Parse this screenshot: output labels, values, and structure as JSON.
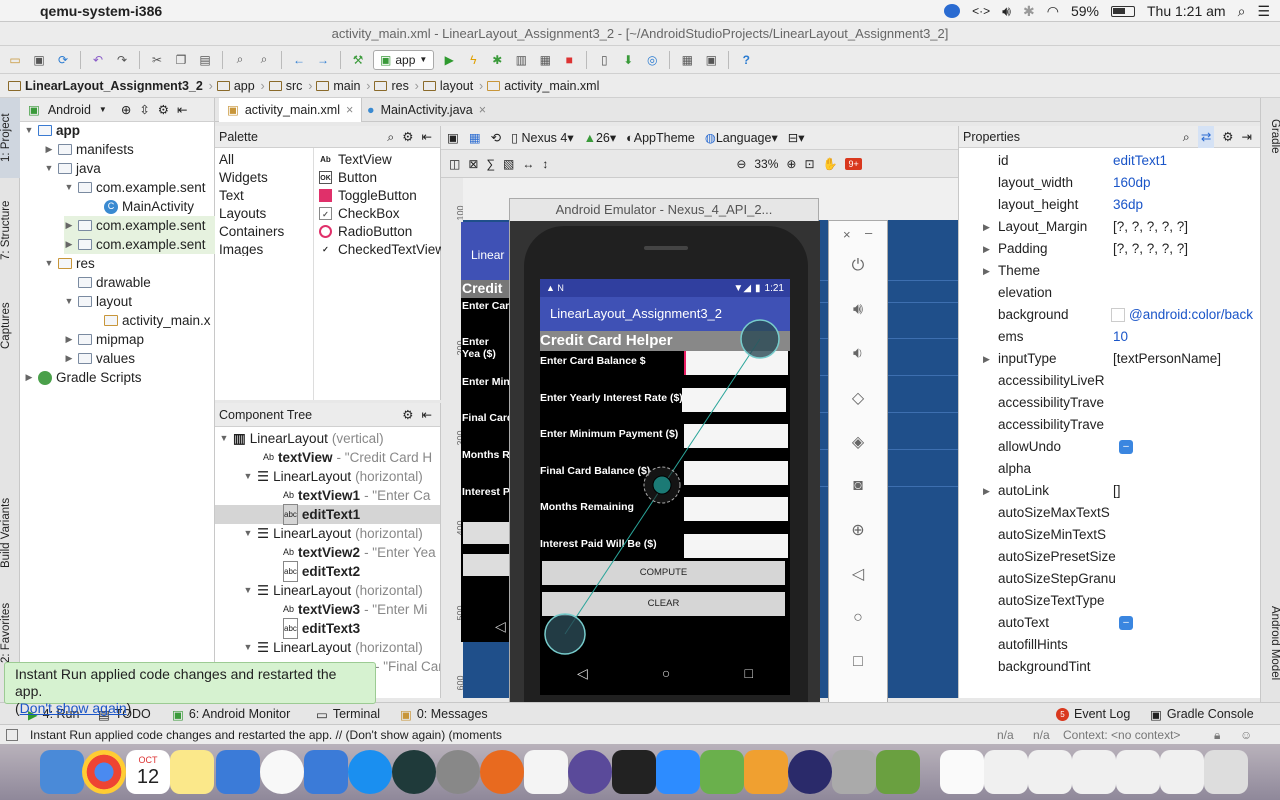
{
  "menubar": {
    "app_name": "qemu-system-i386",
    "battery": "59%",
    "clock": "Thu 1:21 am"
  },
  "window": {
    "title": "activity_main.xml - LinearLayout_Assignment3_2 - [~/AndroidStudioProjects/LinearLayout_Assignment3_2]"
  },
  "toolbar": {
    "run_config": "app"
  },
  "breadcrumbs": [
    "LinearLayout_Assignment3_2",
    "app",
    "src",
    "main",
    "res",
    "layout",
    "activity_main.xml"
  ],
  "left_tabs": [
    "1: Project",
    "7: Structure",
    "Captures",
    "Build Variants",
    "2: Favorites"
  ],
  "right_tabs": [
    "Gradle",
    "Android Model"
  ],
  "project": {
    "view_mode": "Android",
    "items": [
      "app",
      "manifests",
      "java",
      "com.example.sent",
      "MainActivity",
      "com.example.sent",
      "com.example.sent",
      "res",
      "drawable",
      "layout",
      "activity_main.x",
      "mipmap",
      "values",
      "Gradle Scripts"
    ]
  },
  "editor_tabs": [
    "activity_main.xml",
    "MainActivity.java"
  ],
  "palette": {
    "title": "Palette",
    "categories": [
      "All",
      "Widgets",
      "Text",
      "Layouts",
      "Containers",
      "Images"
    ],
    "widgets": [
      "TextView",
      "Button",
      "ToggleButton",
      "CheckBox",
      "RadioButton",
      "CheckedTextView"
    ]
  },
  "component_tree": {
    "title": "Component Tree",
    "rows": [
      {
        "name": "LinearLayout",
        "extra": "(vertical)"
      },
      {
        "name": "textView",
        "extra": "- \"Credit Card H"
      },
      {
        "name": "LinearLayout",
        "extra": "(horizontal)"
      },
      {
        "name": "textView1",
        "extra": "- \"Enter Ca"
      },
      {
        "name": "editText1",
        "extra": ""
      },
      {
        "name": "LinearLayout",
        "extra": "(horizontal)"
      },
      {
        "name": "textView2",
        "extra": "- \"Enter Yea"
      },
      {
        "name": "editText2",
        "extra": ""
      },
      {
        "name": "LinearLayout",
        "extra": "(horizontal)"
      },
      {
        "name": "textView3",
        "extra": "- \"Enter Mi"
      },
      {
        "name": "editText3",
        "extra": ""
      },
      {
        "name": "LinearLayout",
        "extra": "(horizontal)"
      },
      {
        "name": "",
        "extra": "- \"Final Car"
      }
    ]
  },
  "design_toolbar": {
    "device": "Nexus 4",
    "api": "26",
    "theme": "AppTheme",
    "language": "Language",
    "zoom": "33%"
  },
  "blueprint_texts": [
    "Linear",
    "Credit",
    "Enter Car",
    "Enter Yea ($)",
    "Enter Min",
    "Final Card",
    "Months R",
    "Interest P"
  ],
  "ruler_marks": [
    "100",
    "200",
    "300",
    "400",
    "500",
    "600"
  ],
  "properties": {
    "title": "Properties",
    "rows": [
      {
        "name": "id",
        "value": "editText1"
      },
      {
        "name": "layout_width",
        "value": "160dp"
      },
      {
        "name": "layout_height",
        "value": "36dp"
      },
      {
        "name": "Layout_Margin",
        "value": "[?, ?, ?, ?, ?]"
      },
      {
        "name": "Padding",
        "value": "[?, ?, ?, ?, ?]"
      },
      {
        "name": "Theme",
        "value": ""
      },
      {
        "name": "elevation",
        "value": ""
      },
      {
        "name": "background",
        "value": "@android:color/back"
      },
      {
        "name": "ems",
        "value": "10"
      },
      {
        "name": "inputType",
        "value": "[textPersonName]"
      },
      {
        "name": "accessibilityLiveR",
        "value": ""
      },
      {
        "name": "accessibilityTrave",
        "value": ""
      },
      {
        "name": "accessibilityTrave",
        "value": ""
      },
      {
        "name": "allowUndo",
        "value": ""
      },
      {
        "name": "alpha",
        "value": ""
      },
      {
        "name": "autoLink",
        "value": "[]"
      },
      {
        "name": "autoSizeMaxTextS",
        "value": ""
      },
      {
        "name": "autoSizeMinTextS",
        "value": ""
      },
      {
        "name": "autoSizePresetSize",
        "value": ""
      },
      {
        "name": "autoSizeStepGranu",
        "value": ""
      },
      {
        "name": "autoSizeTextType",
        "value": ""
      },
      {
        "name": "autoText",
        "value": ""
      },
      {
        "name": "autofillHints",
        "value": ""
      },
      {
        "name": "backgroundTint",
        "value": ""
      }
    ]
  },
  "emulator": {
    "title": "Android Emulator - Nexus_4_API_2...",
    "time": "1:21",
    "app_title": "LinearLayout_Assignment3_2",
    "heading": "Credit Card Helper",
    "labels": [
      "Enter Card Balance $",
      "Enter Yearly Interest Rate ($)",
      "Enter Minimum Payment ($)",
      "Final Card Balance ($)",
      "Months Remaining",
      "Interest Paid Will Be ($)"
    ],
    "compute": "COMPUTE",
    "clear": "CLEAR"
  },
  "bottom_tools": {
    "run": "4: Run",
    "todo": "TODO",
    "monitor": "6: Android Monitor",
    "terminal": "Terminal",
    "messages": "0: Messages",
    "event_log": "Event Log",
    "gradle_console": "Gradle Console"
  },
  "toast": {
    "line1": "Instant Run applied code changes and restarted the app.",
    "link": "Don't show again"
  },
  "status": {
    "text": "Instant Run applied code changes and restarted the app. // (Don't show again) (moments",
    "na1": "n/a",
    "na2": "n/a",
    "context": "Context: <no context>"
  },
  "dock": {
    "calendar_month": "OCT",
    "calendar_day": "12"
  }
}
